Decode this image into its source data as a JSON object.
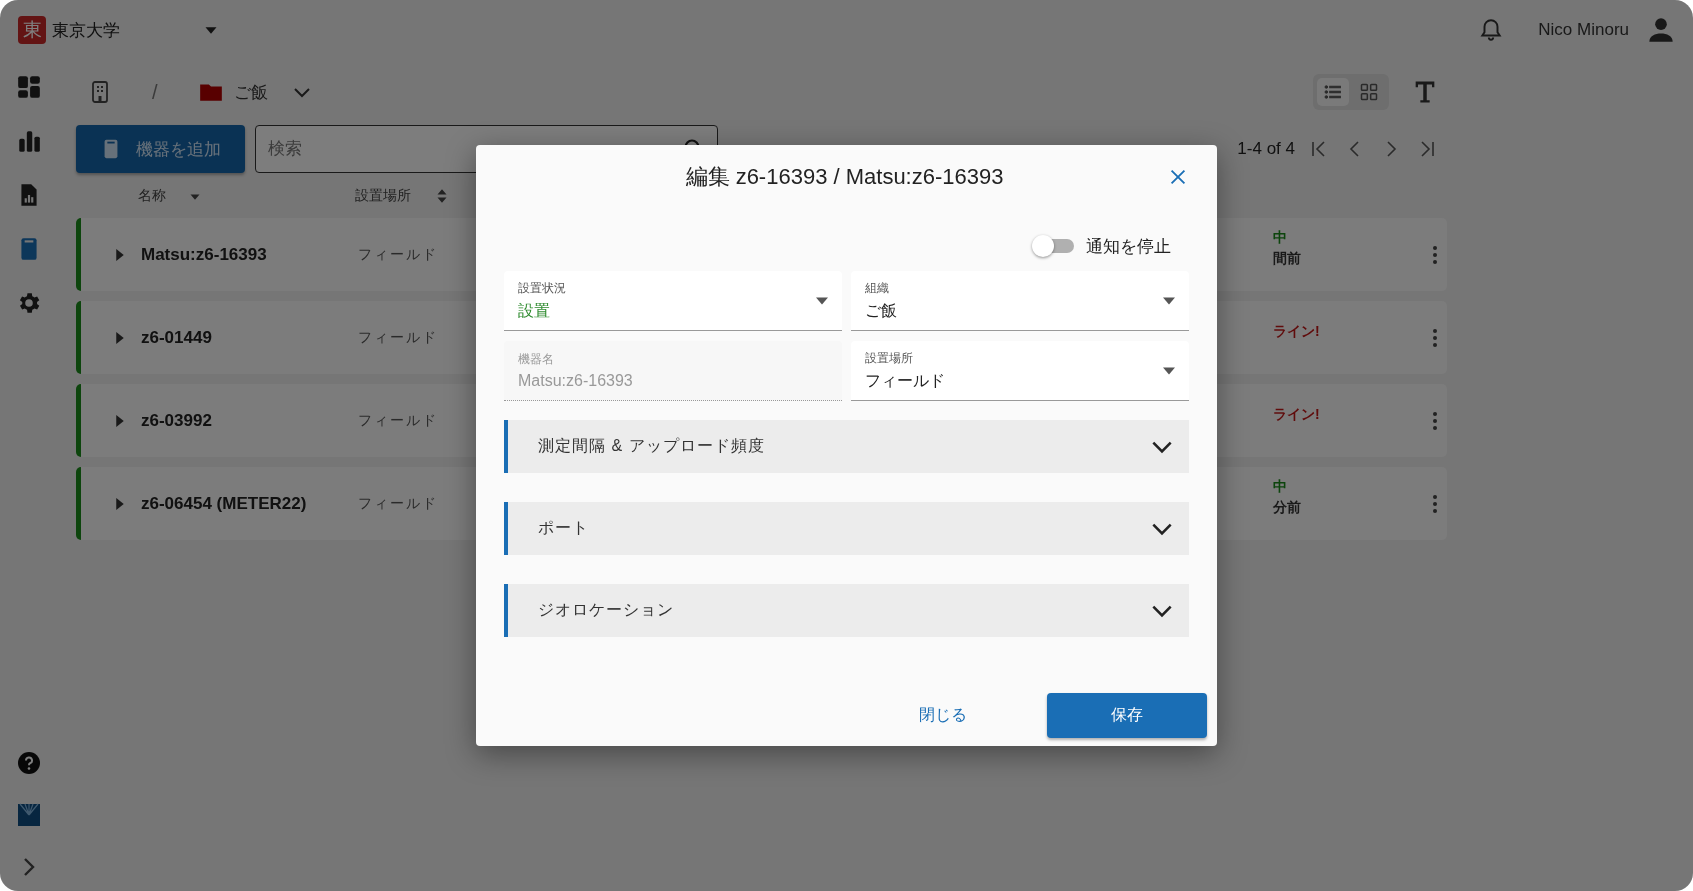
{
  "header": {
    "logo_text": "東",
    "organization": "東京大学",
    "user": "Nico Minoru"
  },
  "sidebar": {
    "items": [
      {
        "kind": "dashboard",
        "selected": false
      },
      {
        "kind": "charts",
        "selected": false
      },
      {
        "kind": "reports",
        "selected": false
      },
      {
        "kind": "devices",
        "selected": true
      },
      {
        "kind": "settings",
        "selected": false
      }
    ],
    "bottom": [
      {
        "kind": "help"
      },
      {
        "kind": "brand"
      },
      {
        "kind": "expand"
      }
    ]
  },
  "breadcrumb": {
    "separator": "/",
    "folder": "ご飯"
  },
  "view_toggle": [
    {
      "kind": "list",
      "selected": true
    },
    {
      "kind": "grid",
      "selected": false
    }
  ],
  "toolbar": {
    "add_button": "機器を追加",
    "search": {
      "placeholder": "検索"
    }
  },
  "pagination": {
    "range": "1-4 of 4"
  },
  "table": {
    "columns": [
      {
        "label": "名称",
        "kind": "sorted"
      },
      {
        "label": "設置場所",
        "kind": "sortable"
      }
    ],
    "rows": [
      {
        "name": "Matsu:z6-16393",
        "location": "フィールド",
        "status": {
          "kind": "online",
          "text": "中",
          "detail": "間前"
        }
      },
      {
        "name": "z6-01449",
        "location": "フィールド",
        "status": {
          "kind": "offline",
          "text": "ライン!"
        }
      },
      {
        "name": "z6-03992",
        "location": "フィールド",
        "status": {
          "kind": "offline",
          "text": "ライン!"
        }
      },
      {
        "name": "z6-06454 (METER22)",
        "location": "フィールド",
        "status": {
          "kind": "online",
          "text": "中",
          "detail": "分前"
        }
      }
    ]
  },
  "dialog": {
    "title": "編集 z6-16393 / Matsu:z6-16393",
    "mute_notifications": {
      "label": "通知を停止",
      "on": false
    },
    "fields": [
      {
        "kind": "select",
        "label": "設置状況",
        "value": "設置",
        "color": "#2e8b2e",
        "disabled": false
      },
      {
        "kind": "select",
        "label": "組織",
        "value": "ご飯",
        "color": "#222222",
        "disabled": false
      },
      {
        "kind": "text",
        "label": "機器名",
        "value": "Matsu:z6-16393",
        "color": "#999999",
        "disabled": true
      },
      {
        "kind": "select",
        "label": "設置場所",
        "value": "フィールド",
        "color": "#222222",
        "disabled": false
      }
    ],
    "sections": [
      {
        "label": "測定間隔 & アップロード頻度",
        "expanded": false
      },
      {
        "label": "ポート",
        "expanded": false
      },
      {
        "label": "ジオロケーション",
        "expanded": false
      }
    ],
    "buttons": [
      {
        "kind": "text",
        "label": "閉じる"
      },
      {
        "kind": "primary",
        "label": "保存"
      }
    ]
  }
}
